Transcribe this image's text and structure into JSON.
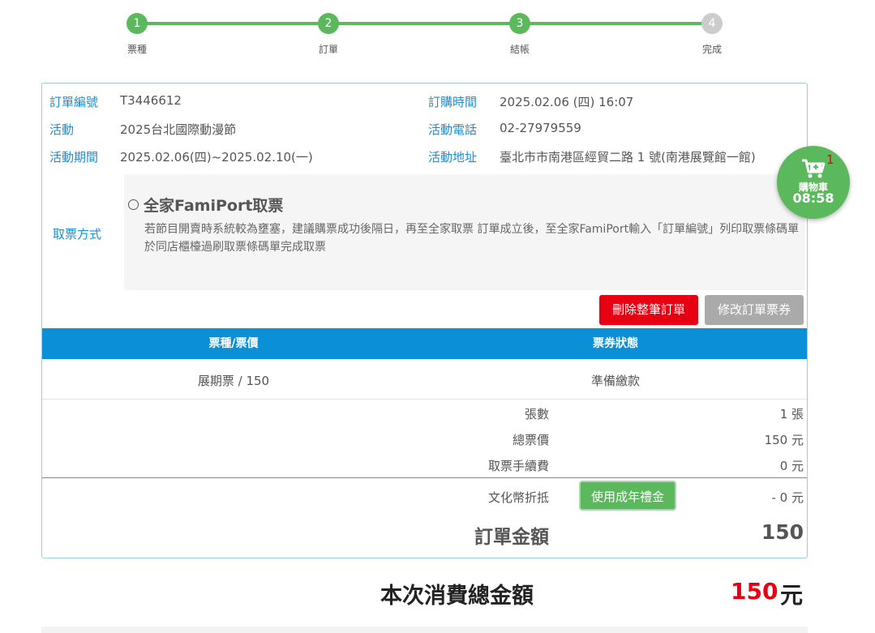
{
  "stepper": {
    "steps": [
      {
        "number": "1",
        "label": "票種"
      },
      {
        "number": "2",
        "label": "訂單"
      },
      {
        "number": "3",
        "label": "結帳"
      },
      {
        "number": "4",
        "label": "完成"
      }
    ],
    "active_color": "#5cb85c",
    "inactive_color": "#cccccc"
  },
  "order": {
    "id_label": "訂單編號",
    "id_value": "T3446612",
    "time_label": "訂購時間",
    "time_value": "2025.02.06 (四) 16:07",
    "event_label": "活動",
    "event_value": "2025台北國際動漫節",
    "phone_label": "活動電話",
    "phone_value": "02-27979559",
    "period_label": "活動期間",
    "period_value": "2025.02.06(四)~2025.02.10(一)",
    "address_label": "活動地址",
    "address_value": "臺北市市南港區經貿二路 1 號(南港展覽館一館)",
    "pickup_label": "取票方式",
    "pickup_option": "全家FamiPort取票",
    "pickup_desc": "若節目開賣時系統較為壅塞，建議購票成功後隔日，再至全家取票 訂單成立後，至全家FamiPort輸入「訂單編號」列印取票條碼單於同店櫃檯過刷取票條碼單完成取票"
  },
  "buttons": {
    "delete_order": "刪除整筆訂單",
    "modify_order": "修改訂單票券",
    "use_youth_credit": "使用成年禮金"
  },
  "table": {
    "headers": [
      "票種/票價",
      "票券狀態"
    ],
    "rows": [
      {
        "ticket": "展期票 / 150",
        "status": "準備繳款"
      }
    ],
    "header_color": "#0b8fd6"
  },
  "summary": {
    "count_label": "張數",
    "count_value": "1 張",
    "total_price_label": "總票價",
    "total_price_value": "150 元",
    "fee_label": "取票手續費",
    "fee_value": "0 元",
    "culture_label": "文化幣折抵",
    "culture_value": "- 0 元",
    "order_total_label": "訂單金額",
    "order_total_value": "150"
  },
  "grand_total": {
    "label": "本次消費總金額",
    "amount": "150",
    "unit": "元",
    "amount_color": "#e60012"
  },
  "cart": {
    "icon": "shopping-cart-icon",
    "count": "1",
    "label": "購物車",
    "timer": "08:58",
    "color": "#5cb85c"
  }
}
